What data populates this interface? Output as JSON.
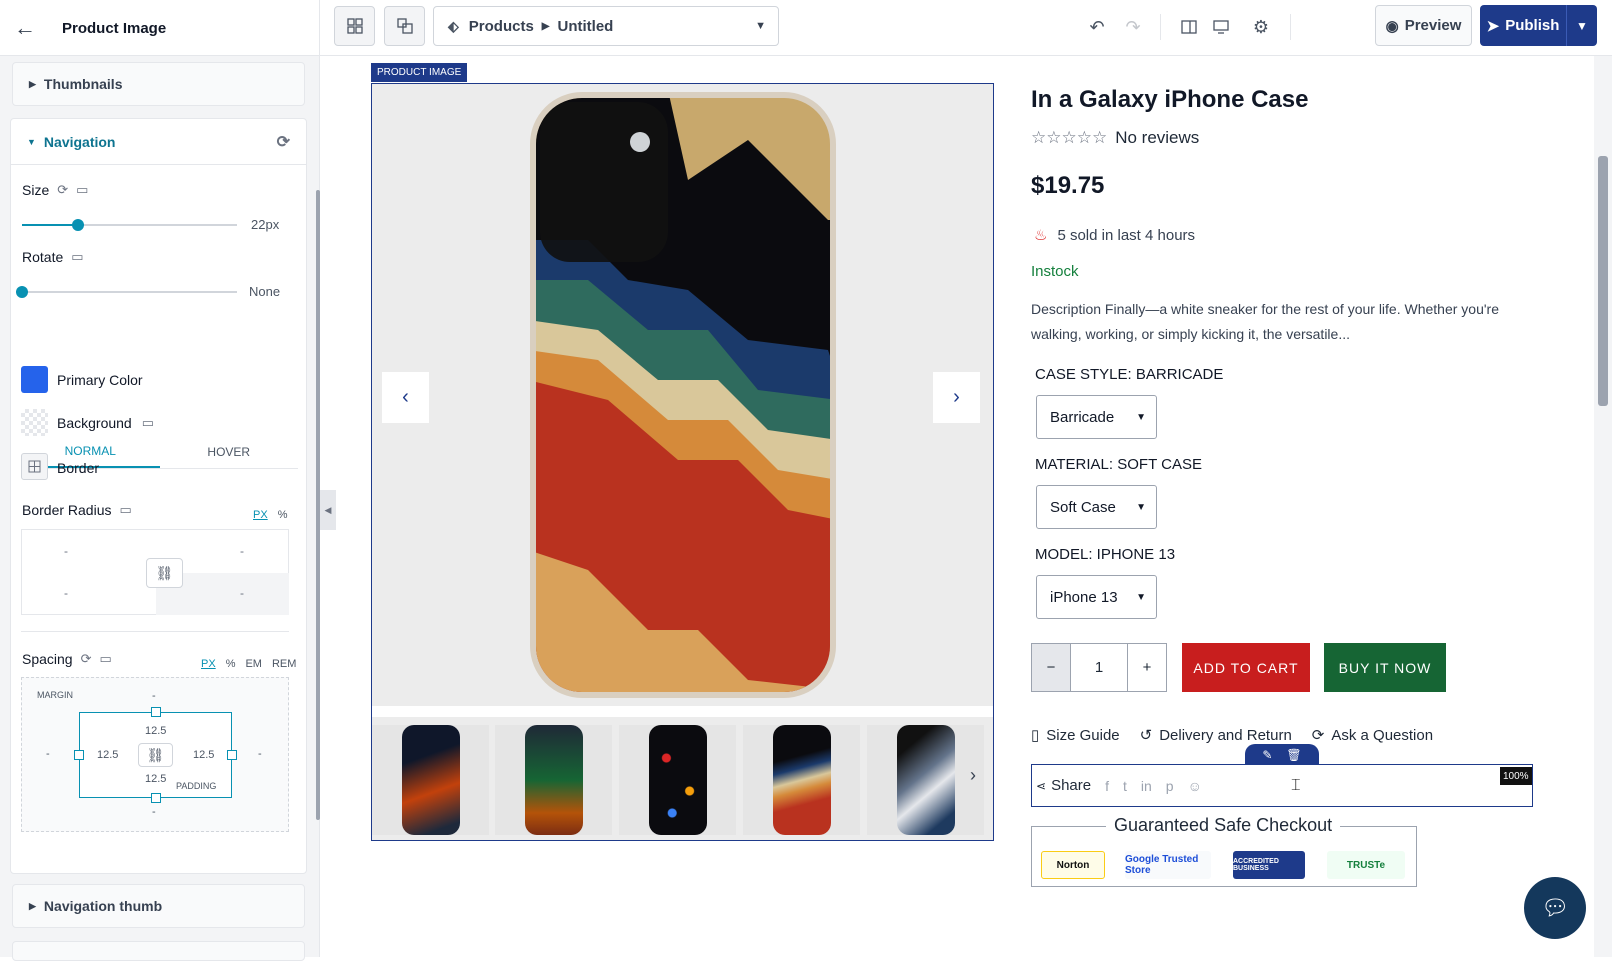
{
  "header": {
    "back_label": "←",
    "title": "Product Image",
    "breadcrumb": {
      "section": "Products",
      "page": "Untitled"
    },
    "preview_label": "Preview",
    "publish_label": "Publish"
  },
  "sidebar": {
    "thumbnails_label": "Thumbnails",
    "navigation": {
      "label": "Navigation",
      "size_label": "Size",
      "size_value": "22px",
      "size_fraction": 0.26,
      "rotate_label": "Rotate",
      "rotate_value": "None",
      "rotate_fraction": 0.0,
      "tabs": [
        {
          "label": "NORMAL",
          "active": true
        },
        {
          "label": "HOVER",
          "active": false
        }
      ],
      "primary_color_label": "Primary Color",
      "primary_color": "#2563eb",
      "background_label": "Background",
      "border_label": "Border",
      "border_radius_label": "Border Radius",
      "radius_units": [
        "PX",
        "%"
      ],
      "radius_values": [
        "-",
        "-",
        "-",
        "-"
      ],
      "spacing_label": "Spacing",
      "spacing_units": [
        "PX",
        "%",
        "EM",
        "REM"
      ],
      "margin_label": "MARGIN",
      "padding_label": "PADDING",
      "margin": {
        "top": "-",
        "right": "-",
        "bottom": "-",
        "left": "-"
      },
      "padding": {
        "top": "12.5",
        "right": "12.5",
        "bottom": "12.5",
        "left": "12.5"
      }
    },
    "navigation_thumb_label": "Navigation thumb"
  },
  "canvas": {
    "selection_tag": "PRODUCT IMAGE",
    "product": {
      "title": "In a Galaxy iPhone Case",
      "reviews": "No reviews",
      "price": "$19.75",
      "sold_text": "5 sold in last 4 hours",
      "stock": "Instock",
      "description": "Description Finally—a white sneaker for the rest of your life. Whether you're walking, working, or simply kicking it, the versatile...",
      "options": [
        {
          "label": "CASE STYLE: BARRICADE",
          "value": "Barricade"
        },
        {
          "label": "MATERIAL: SOFT CASE",
          "value": "Soft Case"
        },
        {
          "label": "MODEL: IPHONE 13",
          "value": "iPhone 13"
        }
      ],
      "qty_minus": "−",
      "quantity": "1",
      "qty_plus": "+",
      "add_to_cart": "ADD TO CART",
      "buy_now": "BUY IT NOW",
      "size_guide": "Size Guide",
      "delivery": "Delivery and Return",
      "ask": "Ask a Question",
      "share_label": "Share",
      "share_zoom": "100%",
      "safe_checkout": "Guaranteed Safe Checkout",
      "badges": [
        "Norton",
        "Google Trusted Store",
        "ACCREDITED BUSINESS",
        "TRUSTe"
      ]
    }
  },
  "colors": {
    "accent": "#0891b2",
    "brand": "#1e3a8a",
    "cart": "#c81e1e",
    "buy": "#166534"
  }
}
